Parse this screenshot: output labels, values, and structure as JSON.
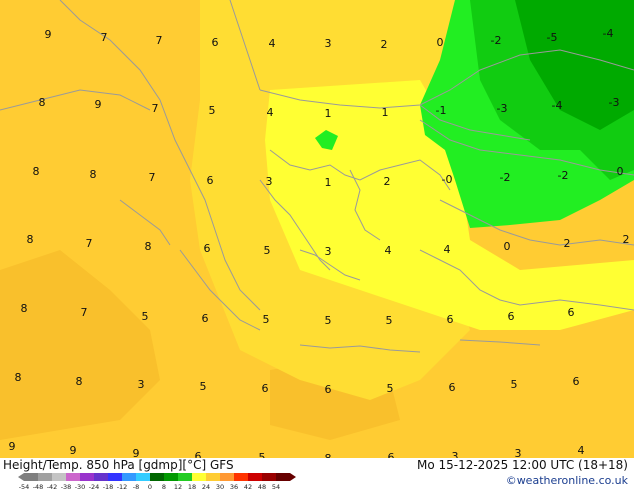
{
  "footer": {
    "title": "Height/Temp. 850 hPa [gdmp][°C] GFS",
    "datetime": "Mo 15-12-2025 12:00 UTC (18+18)",
    "credit": "©weatheronline.co.uk"
  },
  "colors": {
    "background_warm": "#ffcc33",
    "warm_orange": "#f9c02c",
    "mid_yellow": "#ffdd33",
    "bright_yellow": "#ffff33",
    "cold_green_light": "#22ee22",
    "cold_green": "#11cc11",
    "cold_green_dark": "#009900",
    "coastline": "#9a9a9a"
  },
  "temperature_labels": [
    "9",
    "7",
    "7",
    "6",
    "4",
    "3",
    "2",
    "0",
    "-2",
    "-5",
    "-4",
    "8",
    "9",
    "7",
    "5",
    "4",
    "1",
    "1",
    "-1",
    "-3",
    "-4",
    "-3",
    "8",
    "8",
    "7",
    "6",
    "3",
    "1",
    "2",
    "-0",
    "-2",
    "-2",
    "0",
    "8",
    "7",
    "8",
    "6",
    "5",
    "3",
    "4",
    "4",
    "0",
    "2",
    "2",
    "8",
    "7",
    "5",
    "6",
    "5",
    "5",
    "5",
    "6",
    "6",
    "6",
    "8",
    "8",
    "3",
    "5",
    "6",
    "6",
    "5",
    "6",
    "5",
    "6",
    "9",
    "9",
    "9",
    "6",
    "5",
    "8",
    "6",
    "3",
    "3",
    "4"
  ],
  "legend": {
    "tick_labels": [
      "-54",
      "-48",
      "-42",
      "-38",
      "-30",
      "-24",
      "-18",
      "-12",
      "-8",
      "0",
      "8",
      "12",
      "18",
      "24",
      "30",
      "36",
      "42",
      "48",
      "54"
    ],
    "swatches": [
      "#7f7f7f",
      "#a0a0a0",
      "#c4c4c4",
      "#cc66cc",
      "#9933cc",
      "#6633cc",
      "#3333ff",
      "#3399ff",
      "#33ccff",
      "#006600",
      "#009900",
      "#22cc22",
      "#ffff33",
      "#ffcc33",
      "#ff9933",
      "#ff3300",
      "#cc0000",
      "#990000",
      "#660000"
    ]
  }
}
